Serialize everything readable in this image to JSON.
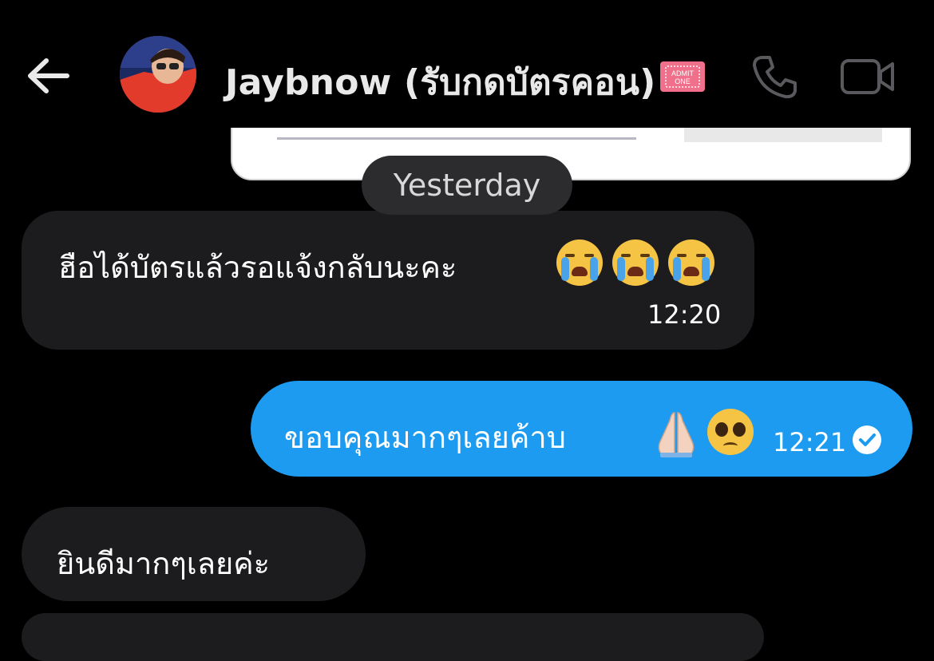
{
  "header": {
    "contact_name": "Jaybnow (รับกดบัตรคอน)",
    "ticket_emoji_text": "ADMIT ONE",
    "icons": [
      "back-arrow-icon",
      "avatar",
      "ticket-emoji-icon",
      "phone-icon",
      "video-camera-icon"
    ]
  },
  "divider": {
    "date_label": "Yesterday"
  },
  "messages": [
    {
      "direction": "incoming",
      "text": "ฮือได้บัตรแล้วรอแจ้งกลับนะคะ",
      "emoji": [
        "loudly-crying-face",
        "loudly-crying-face",
        "loudly-crying-face"
      ],
      "time": "12:20"
    },
    {
      "direction": "outgoing",
      "text": "ขอบคุณมากๆเลยค้าบ",
      "emoji": [
        "folded-hands",
        "pleading-face"
      ],
      "time": "12:21",
      "status": "read-check"
    },
    {
      "direction": "incoming",
      "text": "ยินดีมากๆเลยค่ะ"
    }
  ],
  "colors": {
    "background": "#000000",
    "incoming_bubble": "#1c1c1e",
    "outgoing_bubble": "#1d9bf0",
    "date_pill": "#2c2c2e"
  }
}
